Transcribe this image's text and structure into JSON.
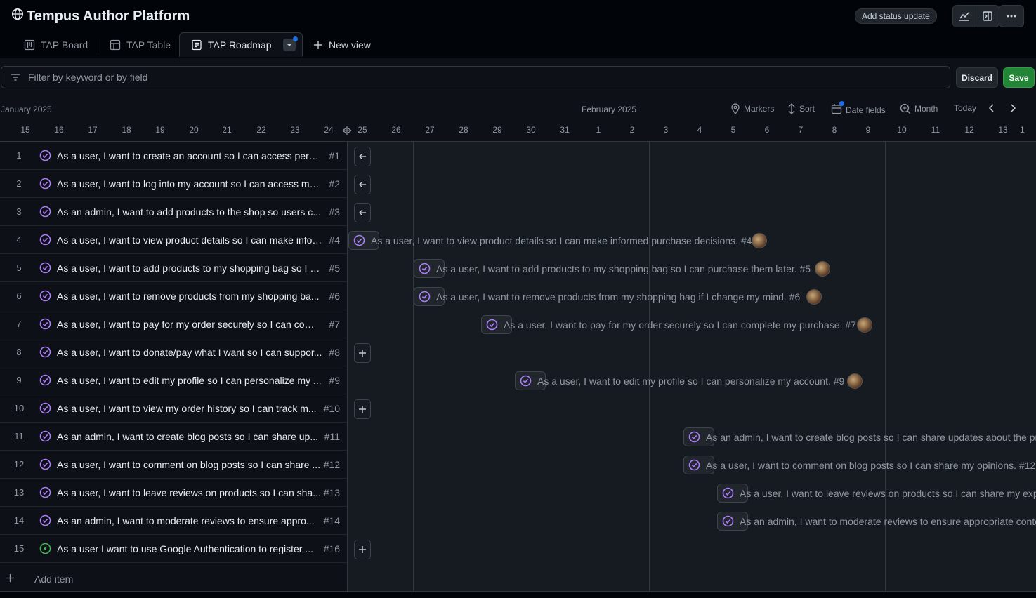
{
  "header": {
    "title": "Tempus Author Platform",
    "status_button": "Add status update"
  },
  "tabs": [
    {
      "label": "TAP Board"
    },
    {
      "label": "TAP Table"
    },
    {
      "label": "TAP Roadmap"
    },
    {
      "label": "New view"
    }
  ],
  "filter": {
    "placeholder": "Filter by keyword or by field"
  },
  "actions": {
    "discard": "Discard",
    "save": "Save"
  },
  "timeline": {
    "month_left": "January 2025",
    "month_right": "February 2025",
    "tools": {
      "markers": "Markers",
      "sort": "Sort",
      "date_fields": "Date fields",
      "zoom": "Month",
      "today": "Today"
    },
    "days": [
      "15",
      "16",
      "17",
      "18",
      "19",
      "20",
      "21",
      "22",
      "23",
      "24",
      "25",
      "26",
      "27",
      "28",
      "29",
      "30",
      "31",
      "1",
      "2",
      "3",
      "4",
      "5",
      "6",
      "7",
      "8",
      "9",
      "10",
      "11",
      "12",
      "13",
      "1"
    ]
  },
  "rows": [
    {
      "num": "1",
      "title": "As a user, I want to create an account so I can access perso...",
      "ref": "#1"
    },
    {
      "num": "2",
      "title": "As a user, I want to log into my account so I can access my ...",
      "ref": "#2"
    },
    {
      "num": "3",
      "title": "As an admin, I want to add products to the shop so users c...",
      "ref": "#3"
    },
    {
      "num": "4",
      "title": "As a user, I want to view product details so I can make infor...",
      "ref": "#4"
    },
    {
      "num": "5",
      "title": "As a user, I want to add products to my shopping bag so I c...",
      "ref": "#5"
    },
    {
      "num": "6",
      "title": "As a user, I want to remove products from my shopping ba...",
      "ref": "#6"
    },
    {
      "num": "7",
      "title": "As a user, I want to pay for my order securely so I can comp...",
      "ref": "#7"
    },
    {
      "num": "8",
      "title": "As a user, I want to donate/pay what I want so I can suppor...",
      "ref": "#8"
    },
    {
      "num": "9",
      "title": "As a user, I want to edit my profile so I can personalize my ...",
      "ref": "#9"
    },
    {
      "num": "10",
      "title": "As a user, I want to view my order history so I can track m...",
      "ref": "#10"
    },
    {
      "num": "11",
      "title": "As an admin, I want to create blog posts so I can share up...",
      "ref": "#11"
    },
    {
      "num": "12",
      "title": "As a user, I want to comment on blog posts so I can share ...",
      "ref": "#12"
    },
    {
      "num": "13",
      "title": "As a user, I want to leave reviews on products so I can sha...",
      "ref": "#13"
    },
    {
      "num": "14",
      "title": "As an admin, I want to moderate reviews to ensure appro...",
      "ref": "#14"
    },
    {
      "num": "15",
      "title": "As a user I want to use Google Authentication to register ...",
      "ref": "#16"
    }
  ],
  "add_item": "Add item",
  "bars": [
    {
      "text": "As a user, I want to view product details so I can make informed purchase decisions. #4"
    },
    {
      "text": "As a user, I want to add products to my shopping bag so I can purchase them later. #5"
    },
    {
      "text": "As a user, I want to remove products from my shopping bag if I change my mind. #6"
    },
    {
      "text": "As a user, I want to pay for my order securely so I can complete my purchase. #7"
    },
    {
      "text": "As a user, I want to edit my profile so I can personalize my account. #9"
    },
    {
      "text": "As an admin, I want to create blog posts so I can share updates about the pr"
    },
    {
      "text": "As a user, I want to comment on blog posts so I can share my opinions. #12"
    },
    {
      "text": "As a user, I want to leave reviews on products so I can share my expe"
    },
    {
      "text": "As an admin, I want to moderate reviews to ensure appropriate conte"
    }
  ],
  "colors": {
    "done": "#ab7df8",
    "open": "#3fb950",
    "accent": "#1f6feb",
    "save": "#238636"
  }
}
